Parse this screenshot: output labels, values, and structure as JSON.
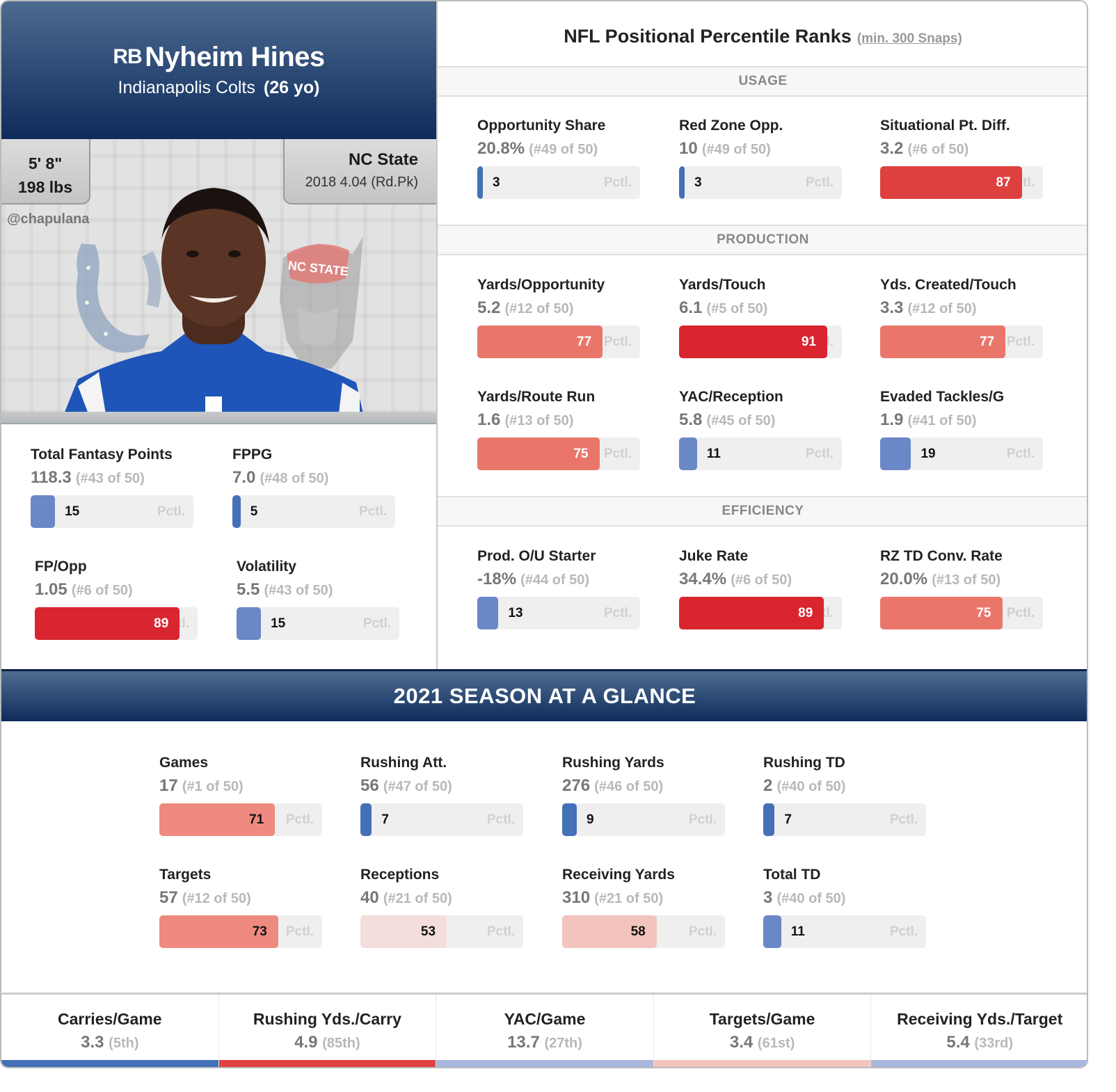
{
  "player": {
    "position": "RB",
    "name": "Nyheim Hines",
    "team": "Indianapolis Colts",
    "age": "(26 yo)",
    "height": "5' 8\"",
    "weight": "198 lbs",
    "college": "NC State",
    "draft": "2018 4.04 (Rd.Pk)",
    "handle": "@chapulana",
    "photo_logos": [
      "colts-horseshoe",
      "nc-state-wolf"
    ]
  },
  "pctl_label": "Pctl.",
  "fantasy": [
    {
      "label": "Total Fantasy Points",
      "value": "118.3",
      "rank": "(#43 of 50)",
      "pctl": 15
    },
    {
      "label": "FPPG",
      "value": "7.0",
      "rank": "(#48 of 50)",
      "pctl": 5
    },
    {
      "label": "FP/Opp",
      "value": "1.05",
      "rank": "(#6 of 50)",
      "pctl": 89
    },
    {
      "label": "Volatility",
      "value": "5.5",
      "rank": "(#43 of 50)",
      "pctl": 15
    }
  ],
  "ranks": {
    "title": "NFL Positional Percentile Ranks",
    "subtitle": "(min. 300 Snaps)",
    "sections": [
      {
        "name": "USAGE",
        "metrics": [
          {
            "label": "Opportunity Share",
            "value": "20.8%",
            "rank": "(#49 of 50)",
            "pctl": 3
          },
          {
            "label": "Red Zone Opp.",
            "value": "10",
            "rank": "(#49 of 50)",
            "pctl": 3
          },
          {
            "label": "Situational Pt. Diff.",
            "value": "3.2",
            "rank": "(#6 of 50)",
            "pctl": 87
          }
        ]
      },
      {
        "name": "PRODUCTION",
        "metrics": [
          {
            "label": "Yards/Opportunity",
            "value": "5.2",
            "rank": "(#12 of 50)",
            "pctl": 77
          },
          {
            "label": "Yards/Touch",
            "value": "6.1",
            "rank": "(#5 of 50)",
            "pctl": 91
          },
          {
            "label": "Yds. Created/Touch",
            "value": "3.3",
            "rank": "(#12 of 50)",
            "pctl": 77
          },
          {
            "label": "Yards/Route Run",
            "value": "1.6",
            "rank": "(#13 of 50)",
            "pctl": 75
          },
          {
            "label": "YAC/Reception",
            "value": "5.8",
            "rank": "(#45 of 50)",
            "pctl": 11
          },
          {
            "label": "Evaded Tackles/G",
            "value": "1.9",
            "rank": "(#41 of 50)",
            "pctl": 19
          }
        ]
      },
      {
        "name": "EFFICIENCY",
        "metrics": [
          {
            "label": "Prod. O/U Starter",
            "value": "-18%",
            "rank": "(#44 of 50)",
            "pctl": 13
          },
          {
            "label": "Juke Rate",
            "value": "34.4%",
            "rank": "(#6 of 50)",
            "pctl": 89
          },
          {
            "label": "RZ TD Conv. Rate",
            "value": "20.0%",
            "rank": "(#13 of 50)",
            "pctl": 75
          }
        ]
      }
    ]
  },
  "season": {
    "title": "2021 SEASON AT A GLANCE",
    "metrics": [
      {
        "label": "Games",
        "value": "17",
        "rank": "(#1 of 50)",
        "pctl": 71
      },
      {
        "label": "Rushing Att.",
        "value": "56",
        "rank": "(#47 of 50)",
        "pctl": 7
      },
      {
        "label": "Rushing Yards",
        "value": "276",
        "rank": "(#46 of 50)",
        "pctl": 9
      },
      {
        "label": "Rushing TD",
        "value": "2",
        "rank": "(#40 of 50)",
        "pctl": 7
      },
      {
        "label": "Targets",
        "value": "57",
        "rank": "(#12 of 50)",
        "pctl": 73
      },
      {
        "label": "Receptions",
        "value": "40",
        "rank": "(#21 of 50)",
        "pctl": 53
      },
      {
        "label": "Receiving Yards",
        "value": "310",
        "rank": "(#21 of 50)",
        "pctl": 58
      },
      {
        "label": "Total TD",
        "value": "3",
        "rank": "(#40 of 50)",
        "pctl": 11
      }
    ]
  },
  "footer": [
    {
      "label": "Carries/Game",
      "value": "3.3",
      "rank": "(5th)",
      "pctl": 5
    },
    {
      "label": "Rushing Yds./Carry",
      "value": "4.9",
      "rank": "(85th)",
      "pctl": 85
    },
    {
      "label": "YAC/Game",
      "value": "13.7",
      "rank": "(27th)",
      "pctl": 27
    },
    {
      "label": "Targets/Game",
      "value": "3.4",
      "rank": "(61st)",
      "pctl": 61
    },
    {
      "label": "Receiving Yds./Target",
      "value": "5.4",
      "rank": "(33rd)",
      "pctl": 33
    }
  ],
  "colors": {
    "header_top": "#4d6a8f",
    "header_bottom": "#0d2c5c",
    "low_blue": "#4470b8",
    "high_red": "#d9232f",
    "bar_bg": "#efefef"
  }
}
